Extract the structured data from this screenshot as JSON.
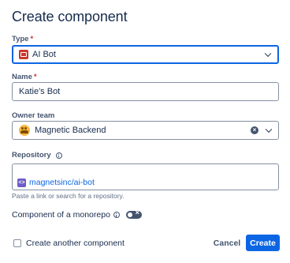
{
  "dialog": {
    "title": "Create component"
  },
  "type_field": {
    "label": "Type",
    "required_mark": "*",
    "value": "AI Bot",
    "icon": "ai-bot-icon"
  },
  "name_field": {
    "label": "Name",
    "required_mark": "*",
    "value": "Katie's Bot"
  },
  "owner_team_field": {
    "label": "Owner team",
    "value": "Magnetic Backend",
    "icon": "team-avatar"
  },
  "repository_field": {
    "label": "Repository",
    "repo_chip": "magnetsinc/ai-bot",
    "helper_text": "Paste a link or search for a repository."
  },
  "monorepo": {
    "label": "Component of a monorepo",
    "toggle_state": "off"
  },
  "footer": {
    "create_another_label": "Create another component",
    "create_another_checked": false,
    "cancel_label": "Cancel",
    "create_label": "Create"
  },
  "colors": {
    "primary": "#0c66e4",
    "required": "#c9372c",
    "ai_bot_icon": "#c9372c",
    "repo_icon": "#6e5dc6"
  }
}
